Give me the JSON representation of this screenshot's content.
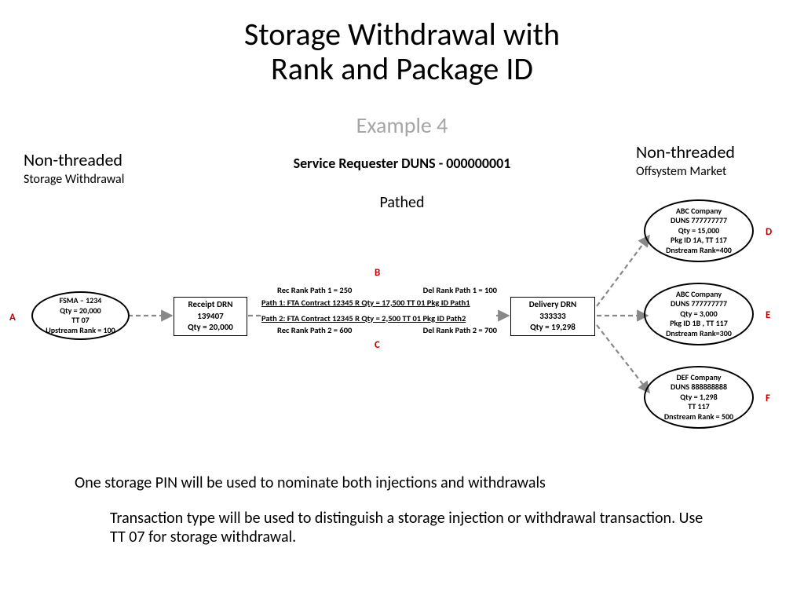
{
  "title_l1": "Storage Withdrawal with",
  "title_l2": "Rank and Package ID",
  "subtitle": "Example 4",
  "left_head_lg": "Non-threaded",
  "left_head_sm": "Storage Withdrawal",
  "right_head_lg": "Non-threaded",
  "right_head_sm": "Offsystem  Market",
  "service_req": "Service Requester DUNS - 000000001",
  "pathed": "Pathed",
  "labels": {
    "A": "A",
    "B": "B",
    "C": "C",
    "D": "D",
    "E": "E",
    "F": "F"
  },
  "nodeA": {
    "l1": "FSMA – 1234",
    "l2": "Qty = 20,000",
    "l3": "TT 07",
    "l4": "Upstream Rank = 100"
  },
  "receipt": {
    "l1": "Receipt DRN",
    "l2": "139407",
    "l3": "Qty = 20,000"
  },
  "delivery": {
    "l1": "Delivery DRN",
    "l2": "333333",
    "l3": "Qty = 19,298"
  },
  "paths": {
    "rec1": "Rec Rank Path 1 = 250",
    "del1": "Del Rank Path 1 = 100",
    "p1": "Path 1:   FTA  Contract  12345  R Qty = 17,500  TT 01  Pkg ID Path1",
    "p2": "Path 2:    FTA  Contract  12345 R Qty = 2,500  TT 01  Pkg ID Path2",
    "rec2": "Rec Rank Path 2 = 600",
    "del2": "Del Rank Path 2 = 700"
  },
  "nodeD": {
    "l1": "ABC Company",
    "l2": "DUNS 777777777",
    "l3": "Qty = 15,000",
    "l4": "Pkg  ID 1A, TT 117",
    "l5": "Dnstream Rank=400"
  },
  "nodeE": {
    "l1": "ABC Company",
    "l2": "DUNS 777777777",
    "l3": "Qty = 3,000",
    "l4": "Pkg  ID 1B , TT 117",
    "l5": "Dnstream Rank=300"
  },
  "nodeF": {
    "l1": "DEF Company",
    "l2": "DUNS 888888888",
    "l3": "Qty = 1,298",
    "l4": "TT 117",
    "l5": "Dnstream Rank = 500"
  },
  "note1": "One storage PIN will be used to nominate both injections and withdrawals",
  "note2": "Transaction type will be used to distinguish a storage injection or withdrawal transaction.  Use TT 07 for storage withdrawal."
}
